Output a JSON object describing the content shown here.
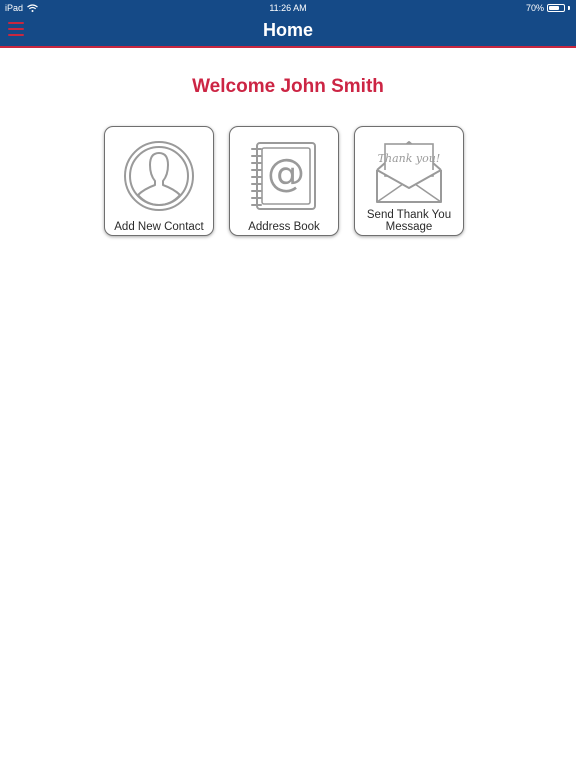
{
  "status_bar": {
    "device": "iPad",
    "time": "11:26 AM",
    "battery": "70%",
    "battery_level": 0.7
  },
  "nav": {
    "title": "Home",
    "menu_icon": "hamburger-menu-icon"
  },
  "welcome": "Welcome John Smith",
  "tiles": [
    {
      "icon": "person-silhouette-icon",
      "label_line1": "Add New Contact",
      "label_line2": ""
    },
    {
      "icon": "address-book-icon",
      "label_line1": "Address Book",
      "label_line2": ""
    },
    {
      "icon": "thank-you-envelope-icon",
      "label_line1": "Send Thank You",
      "label_line2": "Message"
    }
  ],
  "colors": {
    "header": "#154a87",
    "accent": "#cc2544",
    "icon_gray": "#9a9a9a"
  }
}
